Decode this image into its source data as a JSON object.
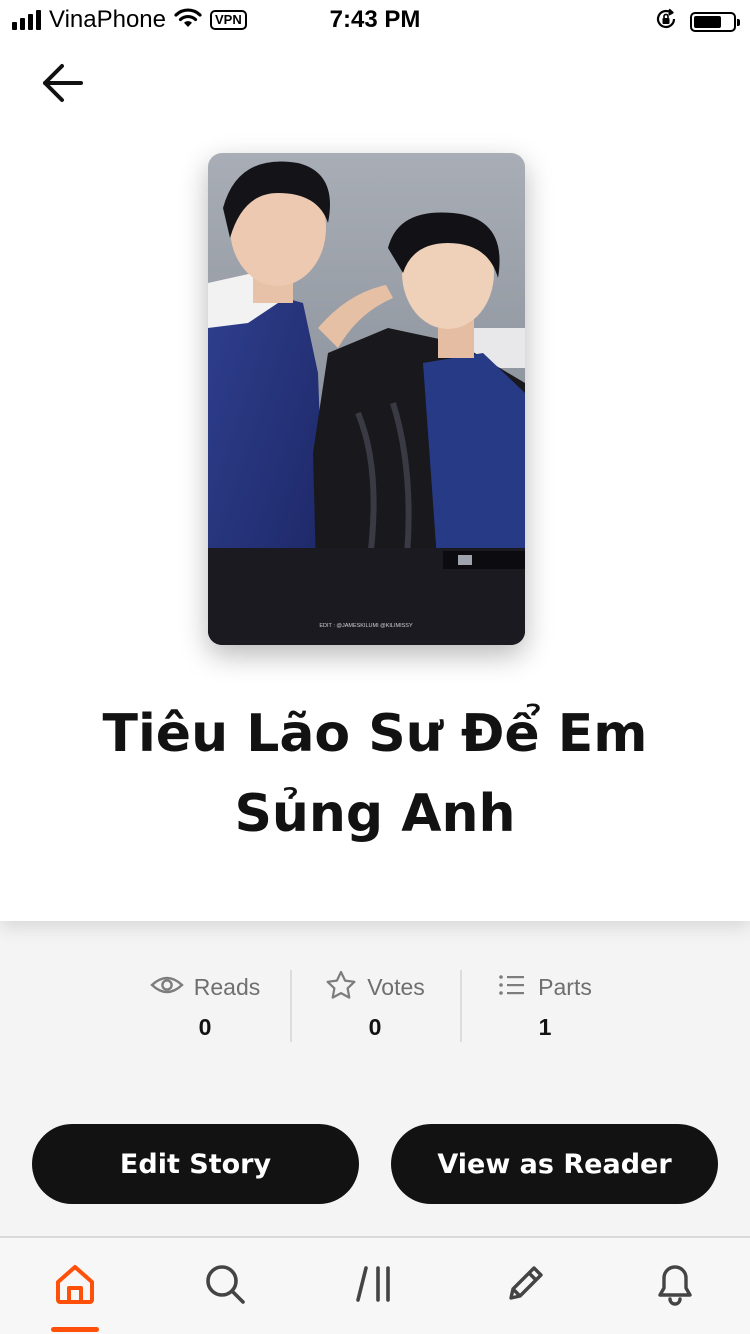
{
  "status_bar": {
    "carrier": "VinaPhone",
    "vpn": "VPN",
    "time": "7:43 PM",
    "battery_level": 0.7
  },
  "icons": {
    "back": "arrow-left-icon",
    "reads": "eye-icon",
    "votes": "star-icon",
    "parts": "list-icon"
  },
  "story": {
    "title": "Tiêu Lão Sư Để Em Sủng Anh",
    "cover_caption": "EDIT : @JAMESKILUMI  @KILIMISSY"
  },
  "stats": [
    {
      "label": "Reads",
      "value": "0",
      "icon": "eye-icon"
    },
    {
      "label": "Votes",
      "value": "0",
      "icon": "star-icon"
    },
    {
      "label": "Parts",
      "value": "1",
      "icon": "list-icon"
    }
  ],
  "actions": {
    "edit_label": "Edit Story",
    "view_label": "View as Reader"
  },
  "bottom_nav": {
    "items": [
      "home-icon",
      "search-icon",
      "library-icon",
      "write-icon",
      "notifications-icon"
    ],
    "active": "home-icon"
  },
  "colors": {
    "accent": "#ff500a",
    "button_bg": "#121212",
    "text_primary": "#121212",
    "text_secondary": "#6f6f6f",
    "page_bg": "#f4f4f4"
  }
}
